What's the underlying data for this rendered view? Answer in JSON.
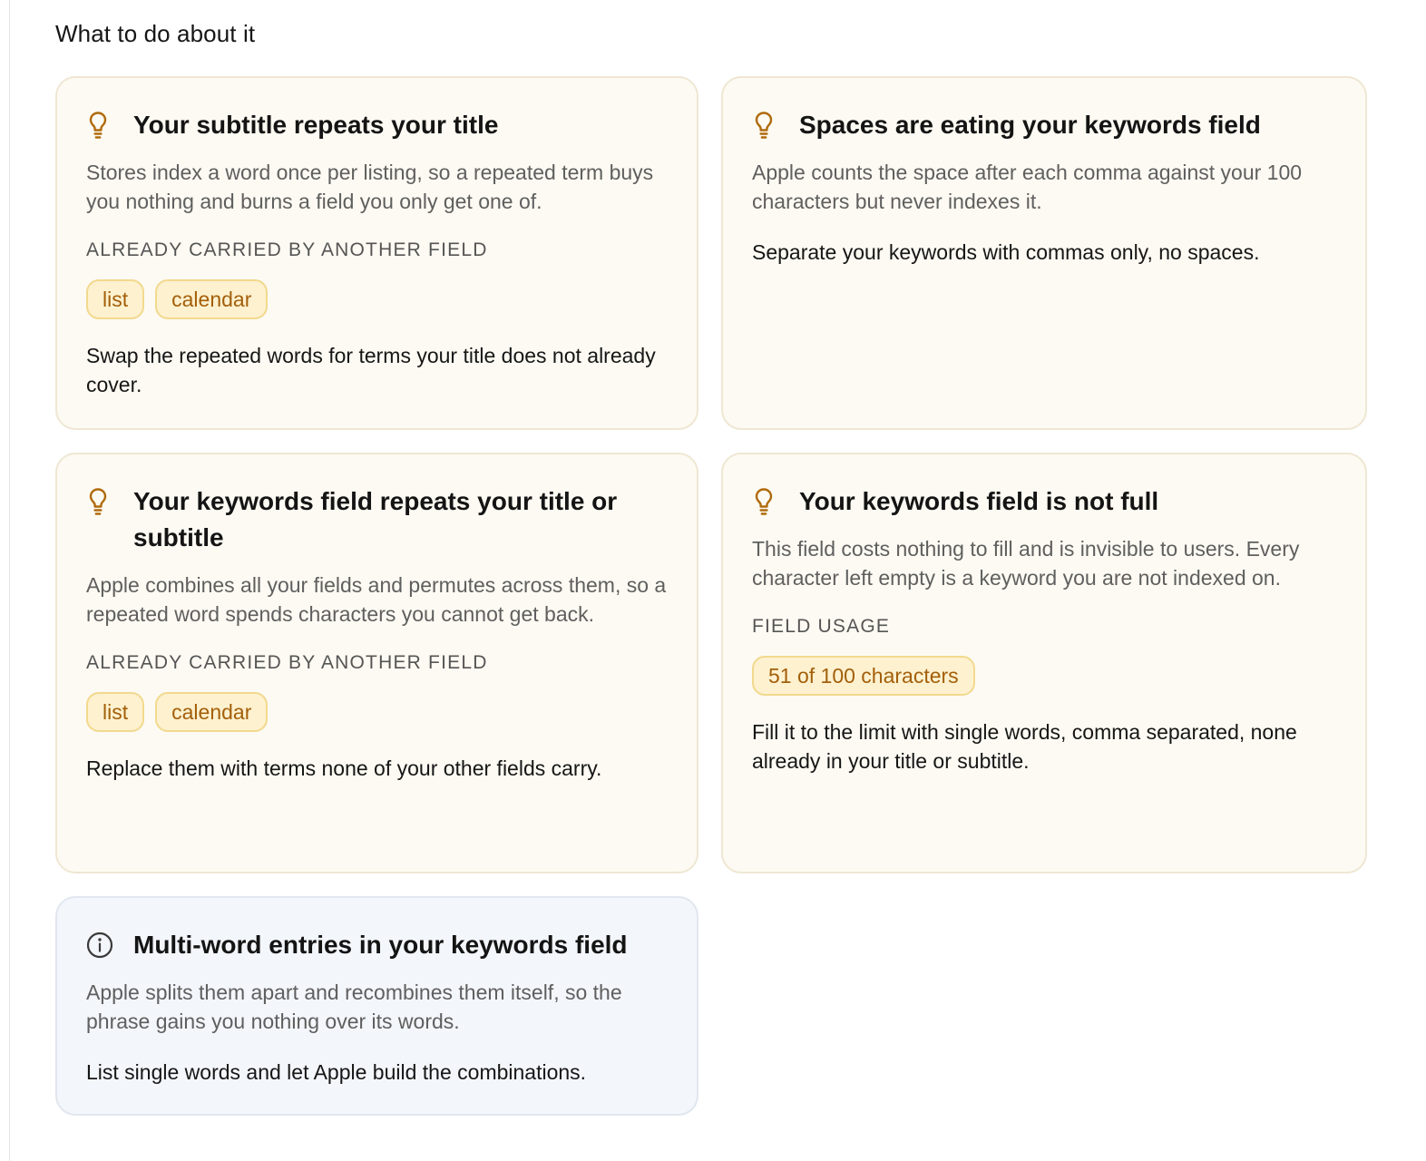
{
  "section": {
    "title": "What to do about it"
  },
  "cards": [
    {
      "icon": "lightbulb-icon",
      "title": "Your subtitle repeats your title",
      "description": "Stores index a word once per listing, so a repeated term buys you nothing and burns a field you only get one of.",
      "eyebrow": "ALREADY CARRIED BY ANOTHER FIELD",
      "chips": [
        "list",
        "calendar"
      ],
      "action": "Swap the repeated words for terms your title does not already cover."
    },
    {
      "icon": "lightbulb-icon",
      "title": "Spaces are eating your keywords field",
      "description": "Apple counts the space after each comma against your 100 characters but never indexes it.",
      "action": "Separate your keywords with commas only, no spaces."
    },
    {
      "icon": "lightbulb-icon",
      "title": "Your keywords field repeats your title or subtitle",
      "description": "Apple combines all your fields and permutes across them, so a repeated word spends characters you cannot get back.",
      "eyebrow": "ALREADY CARRIED BY ANOTHER FIELD",
      "chips": [
        "list",
        "calendar"
      ],
      "action": "Replace them with terms none of your other fields carry."
    },
    {
      "icon": "lightbulb-icon",
      "title": "Your keywords field is not full",
      "description": "This field costs nothing to fill and is invisible to users. Every character left empty is a keyword you are not indexed on.",
      "eyebrow": "FIELD USAGE",
      "chips": [
        "51 of 100 characters"
      ],
      "action": "Fill it to the limit with single words, comma separated, none already in your title or subtitle."
    },
    {
      "icon": "info-circle-icon",
      "title": "Multi-word entries in your keywords field",
      "description": "Apple splits them apart and recombines them itself, so the phrase gains you nothing over its words.",
      "action": "List single words and let Apple build the combinations."
    }
  ],
  "colors": {
    "warning_card_bg": "#fcfaf2",
    "info_card_bg": "#f3f6fa",
    "chip_bg": "#fdf1cf",
    "chip_text": "#a35f0a",
    "icon_accent": "#b06a0c"
  }
}
